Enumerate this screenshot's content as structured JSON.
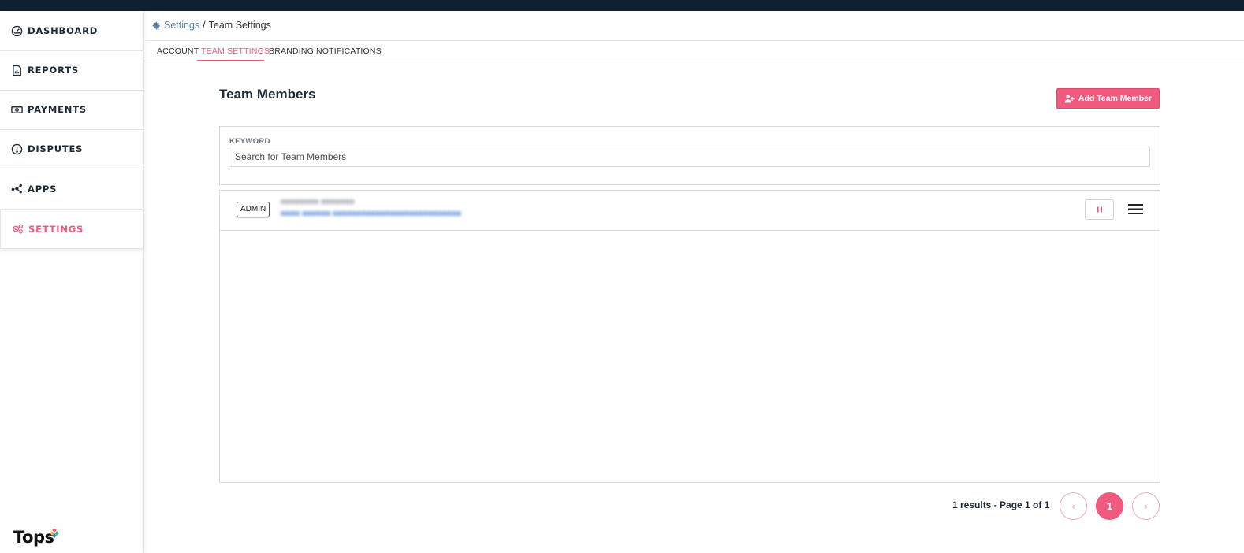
{
  "sidebar": {
    "items": [
      {
        "label": "DASHBOARD",
        "icon": "gauge-icon"
      },
      {
        "label": "REPORTS",
        "icon": "report-file-icon"
      },
      {
        "label": "PAYMENTS",
        "icon": "cash-icon"
      },
      {
        "label": "DISPUTES",
        "icon": "alert-circle-icon"
      },
      {
        "label": "APPS",
        "icon": "network-nodes-icon"
      },
      {
        "label": "SETTINGS",
        "icon": "gears-icon",
        "active": true
      }
    ],
    "logo_text": "Tops"
  },
  "breadcrumb": {
    "root": "Settings",
    "separator": "/",
    "current": "Team Settings"
  },
  "tabs": [
    {
      "label": "ACCOUNT"
    },
    {
      "label": "TEAM SETTINGS",
      "active": true
    },
    {
      "label": "BRANDING"
    },
    {
      "label": "NOTIFICATIONS"
    }
  ],
  "page": {
    "title": "Team Members",
    "add_button_label": "Add Team Member"
  },
  "filter": {
    "keyword_label": "KEYWORD",
    "search_placeholder": "Search for Team Members",
    "search_value": ""
  },
  "members": [
    {
      "role": "ADMIN",
      "name": "■■■■■■■■ ■■■■■■■",
      "email": "■■■■ ■■■■■■ ■■■■■■■■■■■■■■■■■■■■■■■■■■■"
    }
  ],
  "pagination": {
    "summary": "1 results - Page 1 of 1",
    "prev": "‹",
    "current_page": "1",
    "next": "›"
  },
  "colors": {
    "accent": "#ef5a7e",
    "topbar": "#0f2130",
    "link": "#5b7fa8"
  }
}
